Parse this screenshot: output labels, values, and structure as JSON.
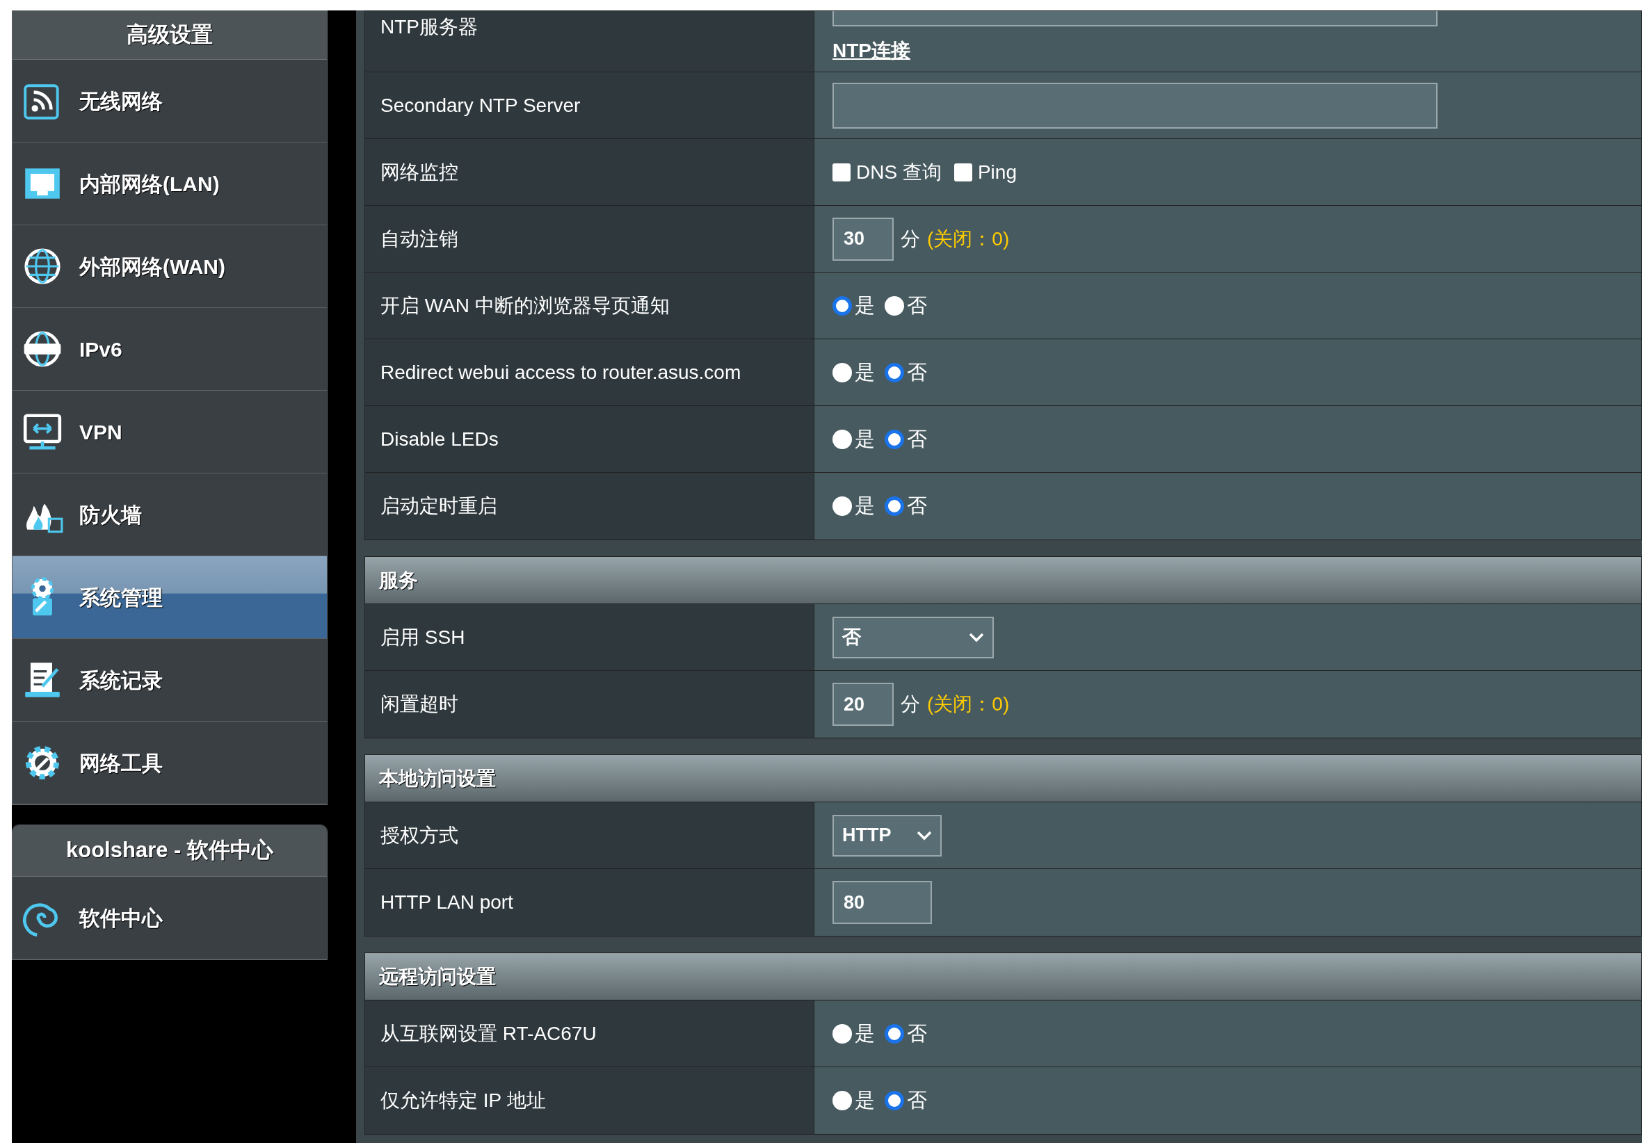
{
  "sidebar": {
    "header": "高级设置",
    "items": [
      {
        "label": "无线网络",
        "selected": false
      },
      {
        "label": "内部网络(LAN)",
        "selected": false
      },
      {
        "label": "外部网络(WAN)",
        "selected": false
      },
      {
        "label": "IPv6",
        "selected": false
      },
      {
        "label": "VPN",
        "selected": false
      },
      {
        "label": "防火墙",
        "selected": false
      },
      {
        "label": "系统管理",
        "selected": true
      },
      {
        "label": "系统记录",
        "selected": false
      },
      {
        "label": "网络工具",
        "selected": false
      }
    ]
  },
  "software_panel": {
    "header": "koolshare - 软件中心",
    "items": [
      {
        "label": "软件中心",
        "selected": false
      }
    ]
  },
  "groups": [
    {
      "rows": [
        {
          "label": "NTP服务器",
          "control": {
            "kind": "cutfield",
            "link": "NTP连接"
          }
        },
        {
          "label": "Secondary NTP Server",
          "control": {
            "kind": "text"
          }
        },
        {
          "label": "网络监控",
          "control": {
            "kind": "checkboxes",
            "options": [
              {
                "label": "DNS 查询",
                "checked": false
              },
              {
                "label": "Ping",
                "checked": false
              }
            ]
          }
        },
        {
          "label": "自动注销",
          "control": {
            "kind": "number",
            "value": "30",
            "unit": "分",
            "hint": "(关闭：0)"
          }
        },
        {
          "label": "开启 WAN 中断的浏览器导页通知",
          "control": {
            "kind": "radio",
            "options": [
              {
                "label": "是",
                "selected": true
              },
              {
                "label": "否",
                "selected": false
              }
            ]
          }
        },
        {
          "label": "Redirect webui access to router.asus.com",
          "control": {
            "kind": "radio",
            "options": [
              {
                "label": "是",
                "selected": false
              },
              {
                "label": "否",
                "selected": true
              }
            ]
          }
        },
        {
          "label": "Disable LEDs",
          "control": {
            "kind": "radio",
            "options": [
              {
                "label": "是",
                "selected": false
              },
              {
                "label": "否",
                "selected": true
              }
            ]
          }
        },
        {
          "label": "启动定时重启",
          "control": {
            "kind": "radio",
            "options": [
              {
                "label": "是",
                "selected": false
              },
              {
                "label": "否",
                "selected": true
              }
            ]
          }
        }
      ]
    },
    {
      "title": "服务",
      "rows": [
        {
          "label": "启用 SSH",
          "control": {
            "kind": "select",
            "value": "否",
            "wide": true
          }
        },
        {
          "label": "闲置超时",
          "control": {
            "kind": "number",
            "value": "20",
            "unit": "分",
            "hint": "(关闭：0)"
          }
        }
      ]
    },
    {
      "title": "本地访问设置",
      "rows": [
        {
          "label": "授权方式",
          "control": {
            "kind": "select",
            "value": "HTTP",
            "wide": false
          }
        },
        {
          "label": "HTTP LAN port",
          "control": {
            "kind": "port",
            "value": "80"
          }
        }
      ]
    },
    {
      "title": "远程访问设置",
      "rows": [
        {
          "label": "从互联网设置 RT-AC67U",
          "control": {
            "kind": "radio",
            "options": [
              {
                "label": "是",
                "selected": false
              },
              {
                "label": "否",
                "selected": true
              }
            ]
          }
        },
        {
          "label": "仅允许特定 IP 地址",
          "control": {
            "kind": "radio",
            "options": [
              {
                "label": "是",
                "selected": false
              },
              {
                "label": "否",
                "selected": true
              }
            ]
          }
        }
      ]
    }
  ]
}
